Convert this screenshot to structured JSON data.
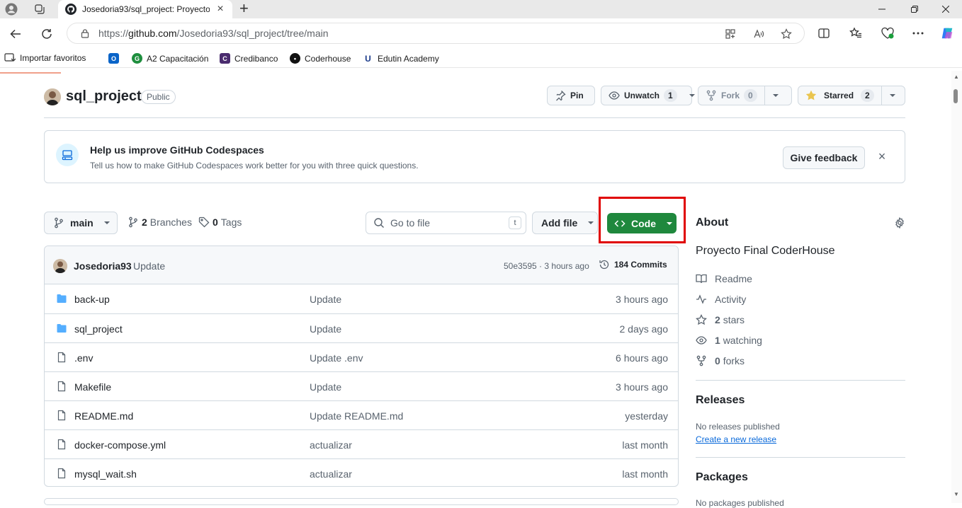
{
  "browser": {
    "tab_title": "Josedoria93/sql_project: Proyecto",
    "url_prefix": "https://",
    "url_host": "github.com",
    "url_path": "/Josedoria93/sql_project/tree/main",
    "favorites": [
      {
        "label": "Importar favoritos"
      },
      {
        "label": ""
      },
      {
        "label": "A2 Capacitación"
      },
      {
        "label": "Credibanco"
      },
      {
        "label": "Coderhouse"
      },
      {
        "label": "Edutin Academy"
      }
    ]
  },
  "repo": {
    "name": "sql_project",
    "visibility": "Public",
    "pin_label": "Pin",
    "unwatch_label": "Unwatch",
    "watch_count": "1",
    "fork_label": "Fork",
    "fork_count": "0",
    "starred_label": "Starred",
    "star_count": "2"
  },
  "banner": {
    "title": "Help us improve GitHub Codespaces",
    "subtitle": "Tell us how to make GitHub Codespaces work better for you with three quick questions.",
    "feedback_label": "Give feedback"
  },
  "toolbar": {
    "branch": "main",
    "branches_count": "2",
    "branches_label": "Branches",
    "tags_count": "0",
    "tags_label": "Tags",
    "search_placeholder": "Go to file",
    "search_kbd": "t",
    "add_file_label": "Add file",
    "code_label": "Code"
  },
  "commit": {
    "author": "Josedoria93",
    "message": "Update",
    "meta": "50e3595 · 3 hours ago",
    "commits_label": "184 Commits"
  },
  "files": [
    {
      "type": "folder",
      "name": "back-up",
      "message": "Update",
      "date": "3 hours ago"
    },
    {
      "type": "folder",
      "name": "sql_project",
      "message": "Update",
      "date": "2 days ago"
    },
    {
      "type": "file",
      "name": ".env",
      "message": "Update .env",
      "date": "6 hours ago"
    },
    {
      "type": "file",
      "name": "Makefile",
      "message": "Update",
      "date": "3 hours ago"
    },
    {
      "type": "file",
      "name": "README.md",
      "message": "Update README.md",
      "date": "yesterday"
    },
    {
      "type": "file",
      "name": "docker-compose.yml",
      "message": "actualizar",
      "date": "last month"
    },
    {
      "type": "file",
      "name": "mysql_wait.sh",
      "message": "actualizar",
      "date": "last month"
    }
  ],
  "about": {
    "heading": "About",
    "description": "Proyecto Final CoderHouse",
    "readme": "Readme",
    "activity": "Activity",
    "stars_count": "2",
    "stars_label": "stars",
    "watching_count": "1",
    "watching_label": "watching",
    "forks_count": "0",
    "forks_label": "forks"
  },
  "releases": {
    "heading": "Releases",
    "none": "No releases published",
    "create_link": "Create a new release"
  },
  "packages": {
    "heading": "Packages",
    "none": "No packages published"
  },
  "colors": {
    "code_button": "#1f883d",
    "highlight_box": "#e00000",
    "link": "#0969da"
  }
}
